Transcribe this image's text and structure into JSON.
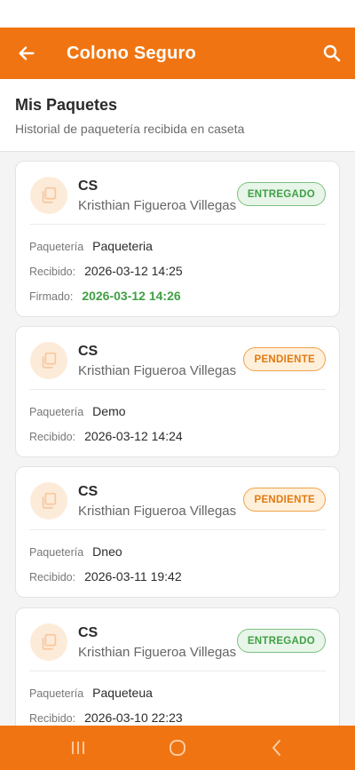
{
  "app": {
    "title": "Colono Seguro"
  },
  "header": {
    "title": "Mis Paquetes",
    "subtitle": "Historial de paquetería recibida en caseta"
  },
  "colors": {
    "accent": "#f07512",
    "delivered": "#3fa044",
    "pending": "#e07a10"
  },
  "packages": [
    {
      "code": "CS",
      "name": "Kristhian Figueroa Villegas",
      "status": "ENTREGADO",
      "courier_label": "Paquetería",
      "courier": "Paqueteria",
      "received_label": "Recibido:",
      "received": "2026-03-12 14:25",
      "signed_label": "Firmado:",
      "signed": "2026-03-12 14:26"
    },
    {
      "code": "CS",
      "name": "Kristhian Figueroa Villegas",
      "status": "PENDIENTE",
      "courier_label": "Paquetería",
      "courier": "Demo",
      "received_label": "Recibido:",
      "received": "2026-03-12 14:24"
    },
    {
      "code": "CS",
      "name": "Kristhian Figueroa Villegas",
      "status": "PENDIENTE",
      "courier_label": "Paquetería",
      "courier": "Dneo",
      "received_label": "Recibido:",
      "received": "2026-03-11 19:42"
    },
    {
      "code": "CS",
      "name": "Kristhian Figueroa Villegas",
      "status": "ENTREGADO",
      "courier_label": "Paquetería",
      "courier": "Paqueteua",
      "received_label": "Recibido:",
      "received": "2026-03-10 22:23"
    }
  ],
  "icons": {
    "back": "arrow-left-icon",
    "search": "search-icon",
    "package": "package-icon",
    "nav_recents": "recents-icon",
    "nav_home": "home-icon",
    "nav_back": "nav-back-icon"
  }
}
